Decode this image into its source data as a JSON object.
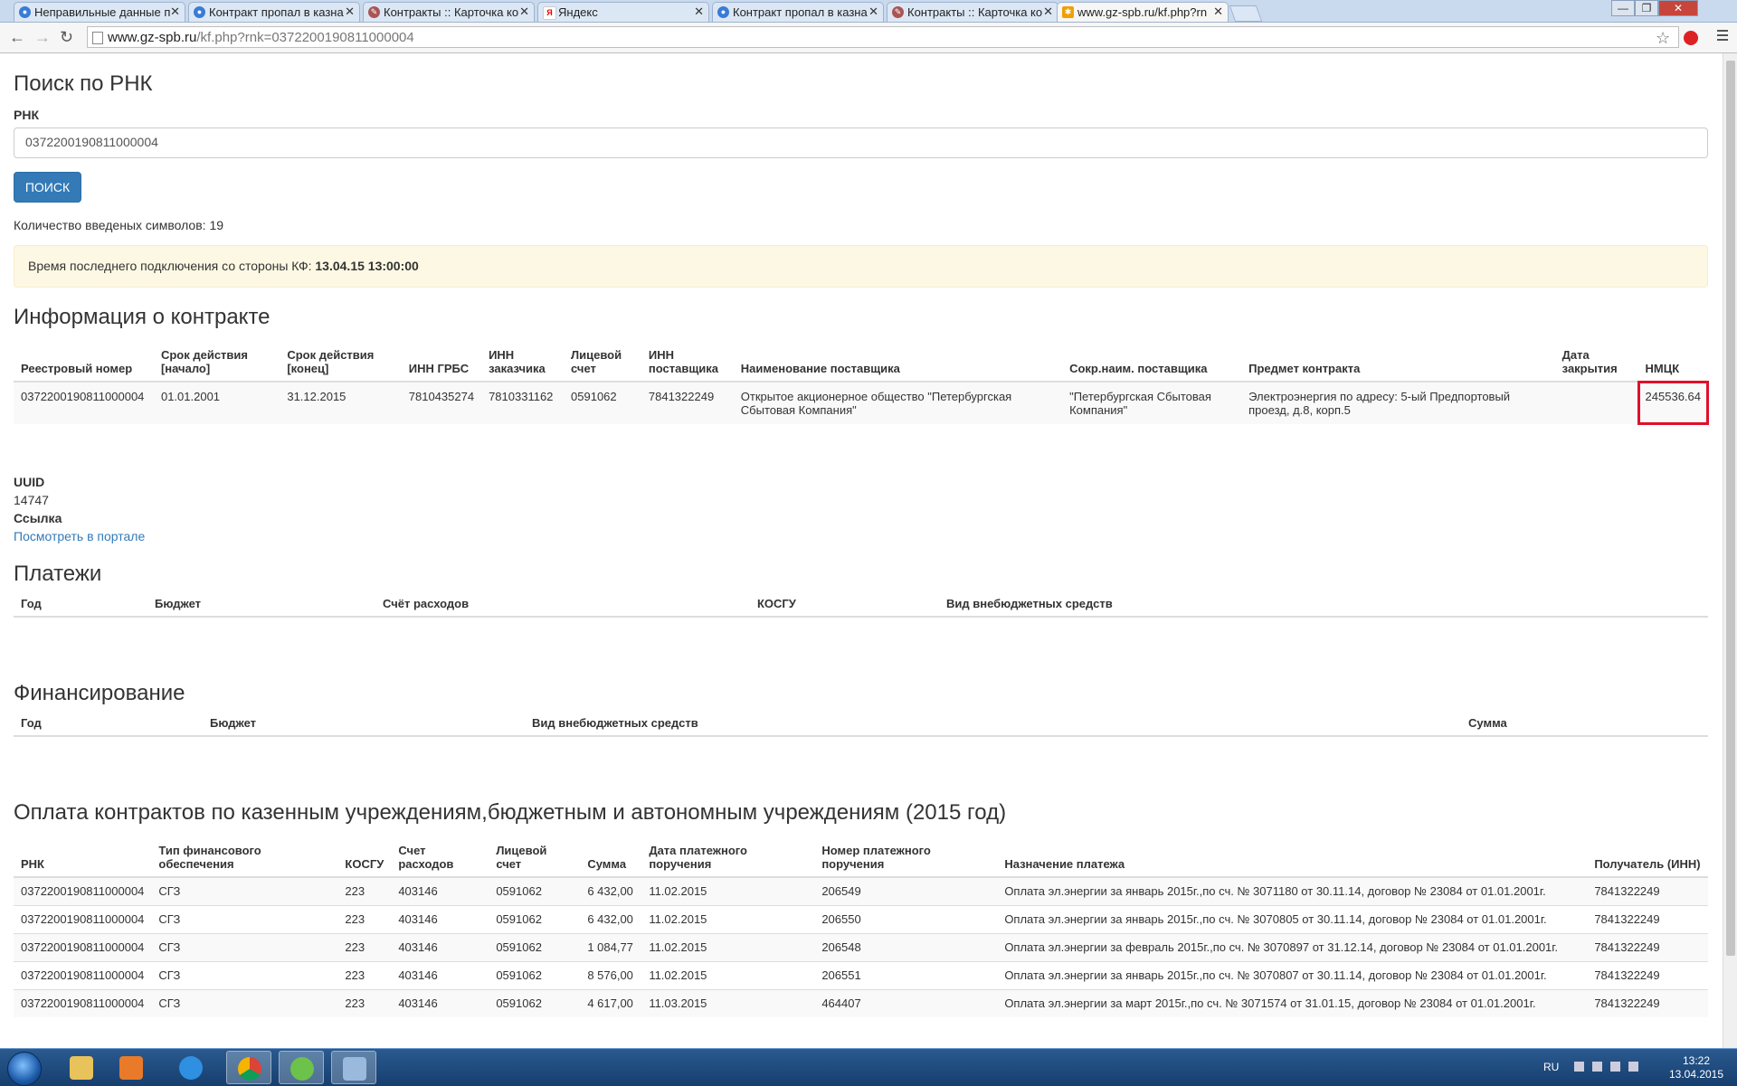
{
  "browser": {
    "tabs": [
      {
        "title": "Неправильные данные п",
        "icon": "browser-tab-globe-icon",
        "active": false
      },
      {
        "title": "Контракт пропал в казна",
        "icon": "browser-tab-globe-icon",
        "active": false
      },
      {
        "title": "Контракты :: Карточка ко",
        "icon": "browser-tab-tools-icon",
        "active": false
      },
      {
        "title": "Яндекс",
        "icon": "yandex-icon",
        "active": false
      },
      {
        "title": "Контракт пропал в казна",
        "icon": "browser-tab-globe-icon",
        "active": false
      },
      {
        "title": "Контракты :: Карточка ко",
        "icon": "browser-tab-tools-icon",
        "active": false
      },
      {
        "title": "www.gz-spb.ru/kf.php?rn",
        "icon": "gz-spb-favicon",
        "active": true
      }
    ],
    "url_host": "www.gz-spb.ru",
    "url_path": "/kf.php?rnk=0372200190811000004"
  },
  "search": {
    "title": "Поиск по РНК",
    "field_label": "РНК",
    "value": "0372200190811000004",
    "button_label": "ПОИСК",
    "count_text": "Количество введеных символов: 19"
  },
  "alert": {
    "text": "Время последнего подключения со стороны КФ: ",
    "time": "13.04.15 13:00:00"
  },
  "contract_info": {
    "title": "Информация о контракте",
    "headers": [
      "Реестровый номер",
      "Срок действия [начало]",
      "Срок действия [конец]",
      "ИНН ГРБС",
      "ИНН заказчика",
      "Лицевой счет",
      "ИНН поставщика",
      "Наименование поставщика",
      "Сокр.наим. поставщика",
      "Предмет контракта",
      "Дата закрытия",
      "НМЦК"
    ],
    "row": [
      "0372200190811000004",
      "01.01.2001",
      "31.12.2015",
      "7810435274",
      "7810331162",
      "0591062",
      "7841322249",
      "Открытое акционерное общество \"Петербургская Сбытовая Компания\"",
      "\"Петербургская Сбытовая Компания\"",
      "Электроэнергия по адресу: 5-ый Предпортовый проезд, д.8, корп.5",
      "",
      "245536.64"
    ]
  },
  "uuid": {
    "label": "UUID",
    "value": "14747",
    "link_label": "Ссылка",
    "link_text": "Посмотреть в портале"
  },
  "payments": {
    "title": "Платежи",
    "headers": [
      "Год",
      "Бюджет",
      "Счёт расходов",
      "КОСГУ",
      "Вид внебюджетных средств"
    ]
  },
  "financing": {
    "title": "Финансирование",
    "headers": [
      "Год",
      "Бюджет",
      "Вид внебюджетных средств",
      "Сумма"
    ]
  },
  "contract_payments": {
    "title": "Оплата контрактов по казенным учреждениям,бюджетным и автономным учреждениям (2015 год)",
    "headers": [
      "РНК",
      "Тип финансового обеспечения",
      "КОСГУ",
      "Счет расходов",
      "Лицевой счет",
      "Сумма",
      "Дата платежного поручения",
      "Номер платежного поручения",
      "Назначение платежа",
      "Получатель (ИНН)"
    ],
    "rows": [
      [
        "0372200190811000004",
        "СГЗ",
        "223",
        "403146",
        "0591062",
        "6 432,00",
        "11.02.2015",
        "206549",
        "Оплата эл.энергии за январь 2015г.,по сч. № 3071180 от 30.11.14, договор № 23084 от 01.01.2001г.",
        "7841322249"
      ],
      [
        "0372200190811000004",
        "СГЗ",
        "223",
        "403146",
        "0591062",
        "6 432,00",
        "11.02.2015",
        "206550",
        "Оплата эл.энергии за январь 2015г.,по сч. № 3070805 от 30.11.14, договор № 23084 от 01.01.2001г.",
        "7841322249"
      ],
      [
        "0372200190811000004",
        "СГЗ",
        "223",
        "403146",
        "0591062",
        "1 084,77",
        "11.02.2015",
        "206548",
        "Оплата эл.энергии за февраль 2015г.,по сч. № 3070897 от 31.12.14, договор № 23084 от 01.01.2001г.",
        "7841322249"
      ],
      [
        "0372200190811000004",
        "СГЗ",
        "223",
        "403146",
        "0591062",
        "8 576,00",
        "11.02.2015",
        "206551",
        "Оплата эл.энергии за январь 2015г.,по сч. № 3070807 от 30.11.14, договор № 23084 от 01.01.2001г.",
        "7841322249"
      ],
      [
        "0372200190811000004",
        "СГЗ",
        "223",
        "403146",
        "0591062",
        "4 617,00",
        "11.03.2015",
        "464407",
        "Оплата эл.энергии за март 2015г.,по сч. № 3071574 от 31.01.15, договор № 23084 от 01.01.2001г.",
        "7841322249"
      ]
    ]
  },
  "taskbar": {
    "lang": "RU",
    "time": "13:22",
    "date": "13.04.2015"
  },
  "colors": {
    "primary_button": "#337ab7",
    "alert_bg": "#fcf8e3",
    "highlight": "#e0102a"
  }
}
